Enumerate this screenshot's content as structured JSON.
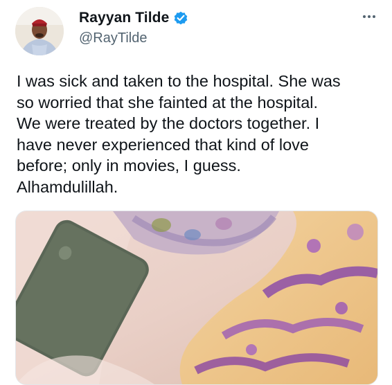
{
  "author": {
    "display_name": "Rayyan Tilde",
    "handle": "@RayTilde",
    "verified": true
  },
  "tweet": {
    "lines": [
      "I was sick and taken to the hospital. She was",
      "so worried that she fainted at the hospital.",
      "We were treated by the doctors together. I",
      "have never experienced that kind of love",
      "before; only in movies, I guess.",
      "Alhamdulillah."
    ]
  },
  "icons": {
    "verified": "verified-badge-icon",
    "more": "more-options-icon"
  },
  "colors": {
    "text": "#0f1419",
    "secondary": "#536471",
    "verified": "#1d9bf0"
  }
}
